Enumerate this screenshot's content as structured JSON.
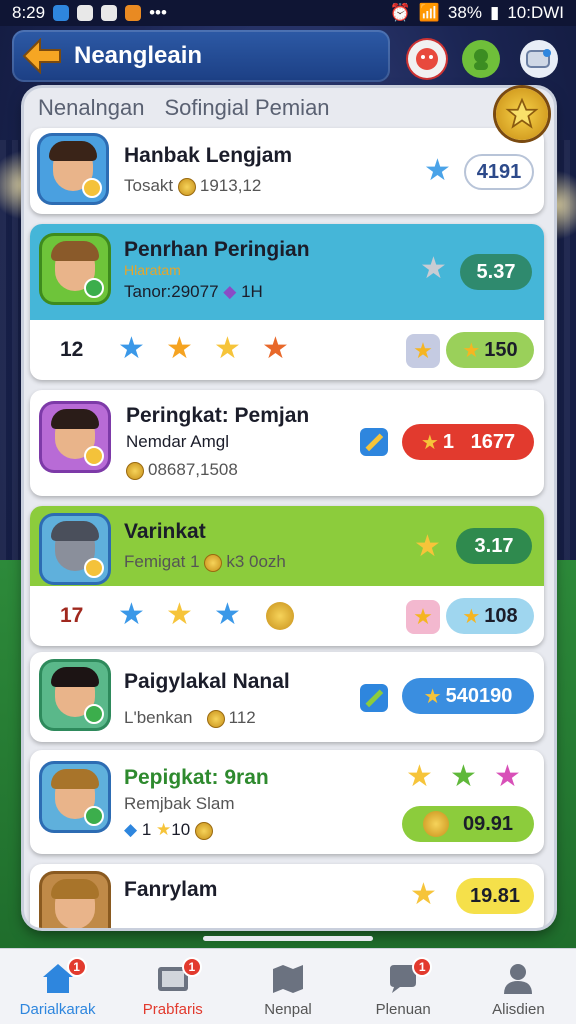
{
  "status_bar": {
    "time": "8:29",
    "battery": "38%",
    "clock_right": "10:DWI"
  },
  "header": {
    "title": "Neanglеain"
  },
  "panel": {
    "tabs": [
      "Nenalngan",
      "Sofingial Pemian"
    ]
  },
  "rows": [
    {
      "name": "Hanbak Lengjam",
      "sub": "Tosakt",
      "coins": "1913,12",
      "score": "4191"
    },
    {
      "name": "Penrhan Peringian",
      "sub": "Hlaratam",
      "tagline": "Tanor:29077",
      "level": "1H",
      "score": "5.37",
      "stats": {
        "rank": "12",
        "bonus": "150"
      }
    },
    {
      "name": "Peringkat: Pemjan",
      "sub": "Nemdar Amgl",
      "coins": "08687,1508",
      "score": "1",
      "score2": "1677"
    },
    {
      "name": "Varinkat",
      "sub": "Femigat 1",
      "extra": "k3 0ozh",
      "score": "3.17",
      "stats": {
        "rank": "17",
        "bonus": "108"
      }
    },
    {
      "name": "Paigylakal Nanal",
      "sub": "L'benkan",
      "coins": "112",
      "score": "540190"
    },
    {
      "name": "Pepigkat: 9ran",
      "sub": "Remjbak Slam",
      "badges": "1",
      "extra": "10",
      "score": "09.91"
    },
    {
      "name": "Fanrylam",
      "score": "19.81"
    }
  ],
  "bottom_nav": [
    {
      "label": "Darialkarak",
      "badge": "1"
    },
    {
      "label": "Prabfaris",
      "badge": "1"
    },
    {
      "label": "Nenpal",
      "badge": ""
    },
    {
      "label": "Plenuan",
      "badge": "1"
    },
    {
      "label": "Alisdien",
      "badge": ""
    }
  ],
  "colors": {
    "accent_blue": "#2d5aa6",
    "highlight_blue": "#45b6d8",
    "highlight_green": "#8ccc3c",
    "gold": "#f6c43a"
  }
}
